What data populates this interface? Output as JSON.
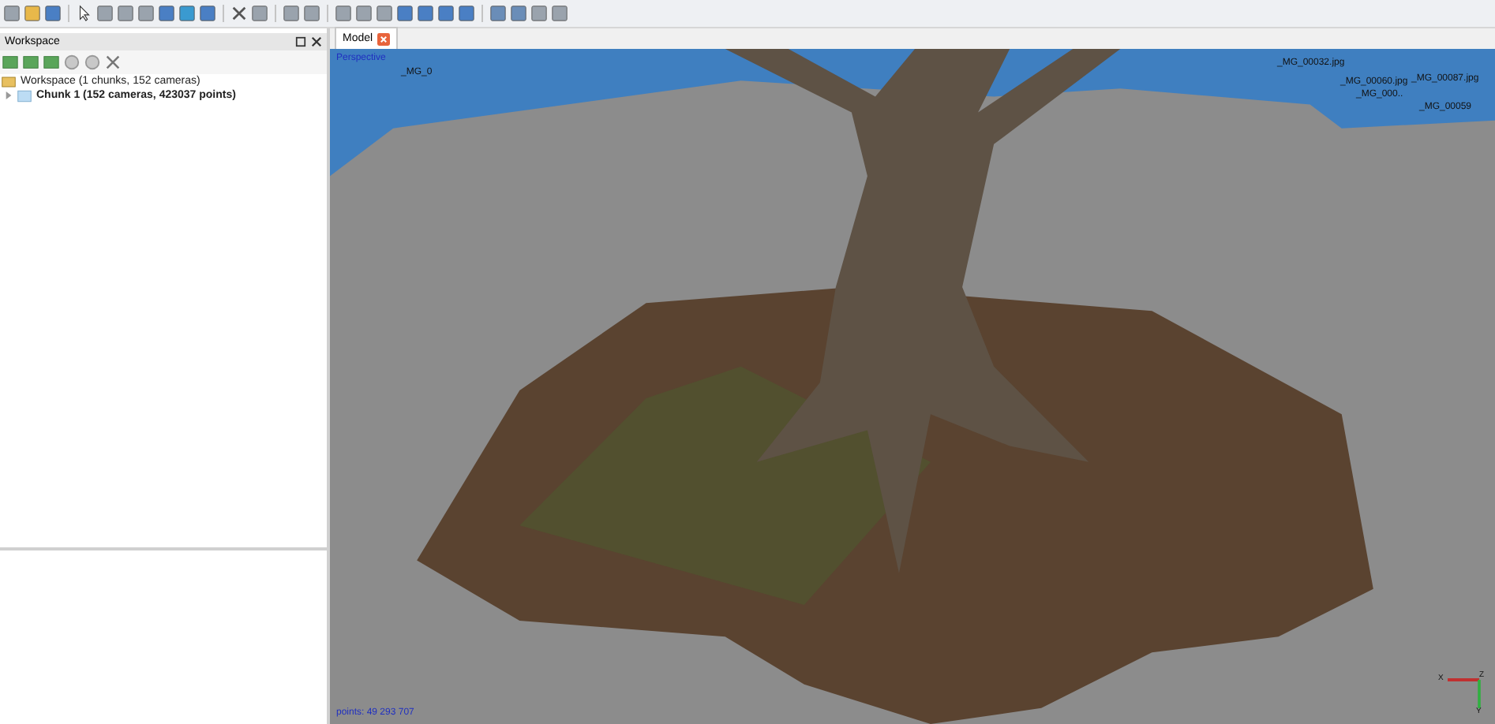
{
  "workspace_panel": {
    "title": "Workspace",
    "tree": [
      {
        "label": "Workspace (1 chunks, 152 cameras)",
        "bold": false,
        "children": [
          {
            "label": "Chunk 1 (152 cameras, 423037 points)",
            "bold": true,
            "expanded": false
          }
        ]
      }
    ]
  },
  "tabs": [
    {
      "label": "Model",
      "selected": true
    }
  ],
  "viewport": {
    "projection": "Perspective",
    "points": "points: 49 293 707",
    "camera_labels": [
      {
        "text": "_MG_0"
      },
      {
        "text": "_MG_00032.jpg"
      },
      {
        "text": "_MG_00060.jpg"
      },
      {
        "text": "_MG_000.."
      },
      {
        "text": "_MG_00087.jpg"
      },
      {
        "text": "_MG_00059"
      }
    ],
    "axes": [
      {
        "label": "X"
      },
      {
        "label": "Z"
      },
      {
        "label": "Y"
      }
    ]
  }
}
